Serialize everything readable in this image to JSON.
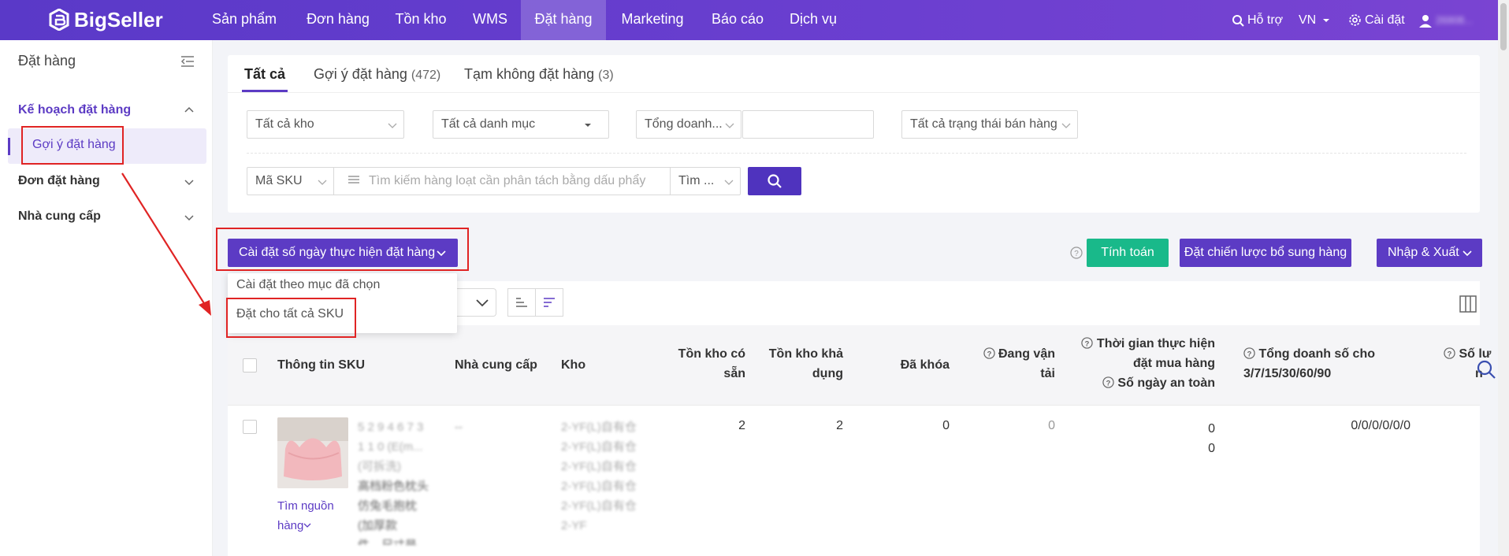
{
  "nav": {
    "logo": "BigSeller",
    "items": [
      "Sản phẩm",
      "Đơn hàng",
      "Tồn kho",
      "WMS",
      "Đặt hàng",
      "Marketing",
      "Báo cáo",
      "Dịch vụ"
    ],
    "support": "Hỗ trợ",
    "lang": "VN",
    "settings": "Cài đặt",
    "user": "26908..."
  },
  "sidebar": {
    "title": "Đặt hàng",
    "groups": [
      {
        "label": "Kế hoạch đặt hàng",
        "sub": "Gợi ý đặt hàng"
      },
      {
        "label": "Đơn đặt hàng"
      },
      {
        "label": "Nhà cung cấp"
      }
    ]
  },
  "tabs": [
    {
      "label": "Tất cả",
      "count": ""
    },
    {
      "label": "Gợi ý đặt hàng",
      "count": "(472)"
    },
    {
      "label": "Tạm không đặt hàng",
      "count": "(3)"
    }
  ],
  "filters": {
    "warehouse": "Tất cả kho",
    "category": "Tất cả danh mục",
    "sales_metric": "Tổng doanh...",
    "sales_value": "",
    "sale_status": "Tất cả trạng thái bán hàng",
    "search_field": "Mã SKU",
    "search_placeholder": "Tìm kiếm hàng loạt cần phân tách bằng dấu phẩy",
    "search_mode": "Tìm ..."
  },
  "actions": {
    "plan_days": "Cài đặt số ngày thực hiện đặt hàng",
    "calc": "Tính toán",
    "strategy": "Đặt chiến lược bổ sung hàng",
    "import_export": "Nhập & Xuất"
  },
  "dropdown_menu": [
    "Cài đặt theo mục đã chọn",
    "Đặt cho tất cả SKU"
  ],
  "table": {
    "headers": {
      "sku": "Thông tin SKU",
      "supplier": "Nhà cung cấp",
      "warehouse": "Kho",
      "stock_available_1": "Tồn kho có",
      "stock_available_2": "sẵn",
      "stock_usable_1": "Tồn kho khả",
      "stock_usable_2": "dụng",
      "locked": "Đã khóa",
      "in_transit_1": "Đang vận",
      "in_transit_2": "tải",
      "lead_time_1": "Thời gian thực hiện",
      "lead_time_2": "đặt mua hàng",
      "safety_days": "Số ngày an toàn",
      "total_sales_1": "Tổng doanh số cho",
      "total_sales_2": "3/7/15/30/60/90",
      "more_1": "Số lư",
      "more_2": "n"
    },
    "row": {
      "sku_lines": [
        "5 2 9 4 6 7 3",
        "1 1 0 (E(m...",
        "(可拆洗)",
        "高档粉色枕头",
        "仿兔毛抱枕",
        "(加厚款",
        "件，尺寸是"
      ],
      "supplier": "--",
      "warehouses": [
        "2-YF(L)自有仓",
        "2-YF(L)自有仓",
        "2-YF(L)自有仓",
        "2-YF(L)自有仓",
        "2-YF(L)自有仓",
        "2-YF"
      ],
      "find_source": "Tìm nguồn",
      "find_source_2": "hàng",
      "stock_available": "2",
      "stock_usable": "2",
      "locked": "0",
      "in_transit": "0",
      "lead_time": "0",
      "safety_days": "0",
      "total_sales": "0/0/0/0/0/0"
    }
  }
}
